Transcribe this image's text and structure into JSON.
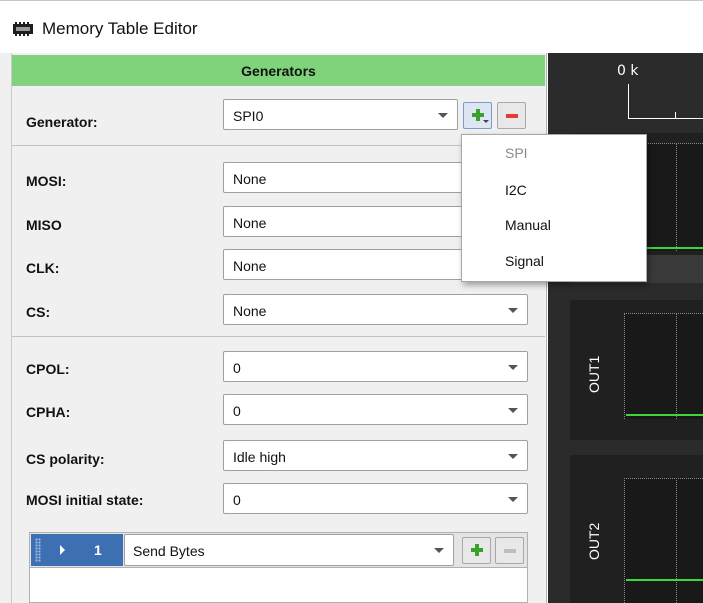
{
  "window": {
    "title": "Memory Table Editor"
  },
  "generators_panel": {
    "header": "Generators",
    "generator_label": "Generator:",
    "generator_value": "SPI0"
  },
  "pins": [
    {
      "label": "MOSI:",
      "value": "None"
    },
    {
      "label": "MISO",
      "value": "None"
    },
    {
      "label": "CLK:",
      "value": "None"
    },
    {
      "label": "CS:",
      "value": "None"
    }
  ],
  "settings": [
    {
      "label": "CPOL:",
      "value": "0"
    },
    {
      "label": "CPHA:",
      "value": "0"
    },
    {
      "label": "CS polarity:",
      "value": "Idle high"
    },
    {
      "label": "MOSI initial state:",
      "value": "0"
    }
  ],
  "sequence": {
    "items": [
      {
        "index": "1",
        "action": "Send Bytes"
      }
    ]
  },
  "add_generator_menu": {
    "options": [
      "SPI",
      "I2C",
      "Manual",
      "Signal"
    ],
    "disabled_option": "SPI"
  },
  "timeline": {
    "ruler_label": "0 k",
    "channels": [
      "OUT1",
      "OUT2"
    ]
  },
  "colors": {
    "header_green": "#7ed37b",
    "signal_green": "#3dd63d",
    "plot_background": "#2b2b2b",
    "selected_row_blue": "#3d6fb3",
    "remove_red": "#e23b3b"
  },
  "icons": {
    "app": "memory-chip-icon",
    "add": "plus-icon",
    "remove": "minus-icon",
    "dropdown": "chevron-down-icon",
    "expand": "chevron-right-icon",
    "drag": "drag-handle-icon"
  }
}
